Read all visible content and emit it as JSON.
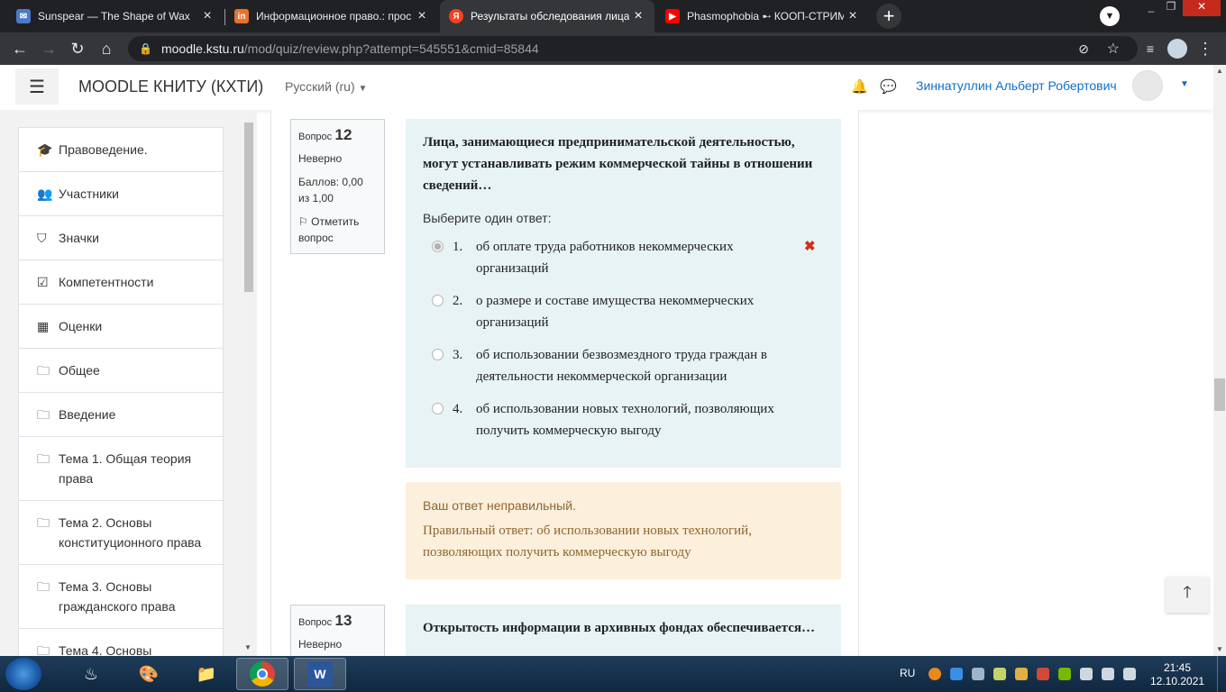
{
  "browser": {
    "tabs": [
      {
        "title": "Sunspear — The Shape of Wax",
        "icon": "chat-icon",
        "color": "#4a7ac9"
      },
      {
        "title": "Информационное право.: прос",
        "icon": "openedu-icon",
        "color": "#e8712e"
      },
      {
        "title": "Результаты обследования лица,",
        "icon": "yandex-icon",
        "color": "#fc3f1d"
      },
      {
        "title": "Phasmophobia ➸ КООП-СТРИМ",
        "icon": "youtube-icon",
        "color": "#ff0000"
      }
    ],
    "url_host": "moodle.kstu.ru",
    "url_path": "/mod/quiz/review.php?attempt=545551&cmid=85844"
  },
  "navbar": {
    "site_name": "MOODLE КНИТУ (КХТИ)",
    "language": "Русский (ru)",
    "user_name": "Зиннатуллин Альберт Робертович"
  },
  "drawer": {
    "items": [
      {
        "label": "Правоведение.",
        "icon": "graduation-cap-icon",
        "glyph": "🎓"
      },
      {
        "label": "Участники",
        "icon": "users-icon",
        "glyph": "👥"
      },
      {
        "label": "Значки",
        "icon": "shield-icon",
        "glyph": "⛉"
      },
      {
        "label": "Компетентности",
        "icon": "checkbox-icon",
        "glyph": "☑"
      },
      {
        "label": "Оценки",
        "icon": "table-icon",
        "glyph": "▦"
      },
      {
        "label": "Общее",
        "icon": "folder-icon",
        "glyph": "🗀"
      },
      {
        "label": "Введение",
        "icon": "folder-icon",
        "glyph": "🗀"
      },
      {
        "label": "Тема 1. Общая теория права",
        "icon": "folder-icon",
        "glyph": "🗀"
      },
      {
        "label": "Тема 2. Основы конституционного права",
        "icon": "folder-icon",
        "glyph": "🗀"
      },
      {
        "label": "Тема 3. Основы гражданского права",
        "icon": "folder-icon",
        "glyph": "🗀"
      },
      {
        "label": "Тема 4. Основы",
        "icon": "folder-icon",
        "glyph": "🗀"
      }
    ]
  },
  "questions": [
    {
      "label": "Вопрос",
      "number": "12",
      "status": "Неверно",
      "score": "Баллов: 0,00 из 1,00",
      "flag": "Отметить вопрос",
      "text": "Лица, занимающиеся предпринимательской деятельностью, могут устанавливать режим коммерческой тайны в отношении сведений…",
      "prompt": "Выберите один ответ:",
      "answers": [
        {
          "num": "1.",
          "text": "об оплате труда работников некоммерческих организаций",
          "checked": true,
          "wrong": "✖"
        },
        {
          "num": "2.",
          "text": "о размере и составе имущества некоммерческих организаций",
          "checked": false
        },
        {
          "num": "3.",
          "text": "об использовании безвозмездного труда граждан в деятельности некоммерческой организации",
          "checked": false
        },
        {
          "num": "4.",
          "text": "об использовании новых технологий, позволяющих получить коммерческую выгоду",
          "checked": false
        }
      ],
      "feedback": {
        "result": "Ваш ответ неправильный.",
        "correct": "Правильный ответ: об использовании новых технологий, позволяющих получить коммерческую выгоду"
      }
    },
    {
      "label": "Вопрос",
      "number": "13",
      "status": "Неверно",
      "text": "Открытость информации в архивных фондах обеспечивается…"
    }
  ],
  "taskbar": {
    "language": "RU",
    "time": "21:45",
    "date": "12.10.2021"
  }
}
